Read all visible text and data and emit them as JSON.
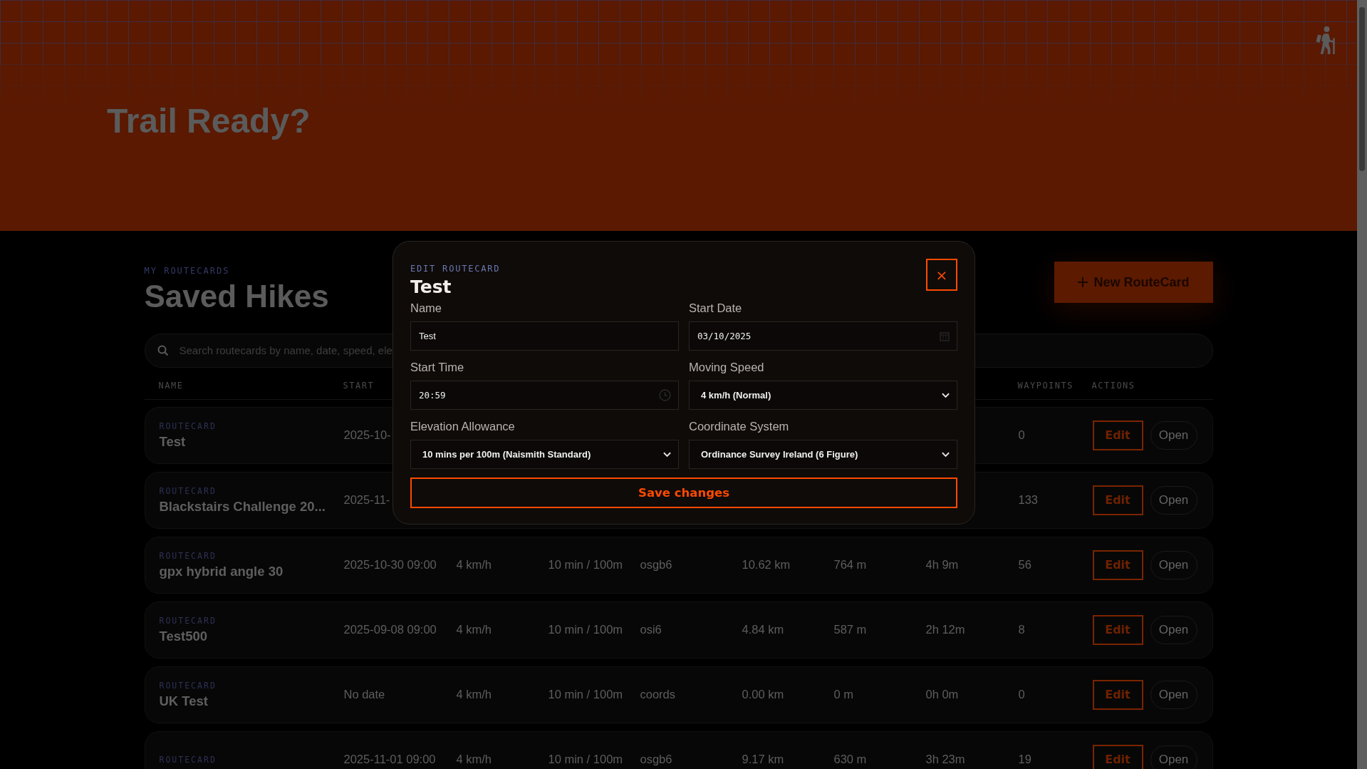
{
  "hero": {
    "title": "Trail Ready?"
  },
  "page": {
    "eyebrow": "MY ROUTECARDS",
    "title": "Saved Hikes",
    "new_button": {
      "label": "New RouteCard"
    }
  },
  "search": {
    "placeholder": "Search routecards by name, date, speed, ele"
  },
  "table": {
    "columns": [
      {
        "label": "NAME"
      },
      {
        "label": "START"
      },
      {
        "label": "WAYPOINTS"
      },
      {
        "label": "ACTIONS"
      }
    ],
    "rows": [
      {
        "label": "ROUTECARD",
        "name": "Test",
        "start": "2025-10-",
        "waypoints": "0",
        "actions": [
          "Edit",
          "Open"
        ]
      },
      {
        "label": "ROUTECARD",
        "name": "Blackstairs Challenge 20...",
        "start": "2025-11-",
        "waypoints": "133",
        "actions": [
          "Edit",
          "Open"
        ]
      },
      {
        "label": "ROUTECARD",
        "name": "gpx hybrid angle 30",
        "start": "2025-10-30 09:00",
        "speed": "4 km/h",
        "elevation": "10 min / 100m",
        "coords": "osgb6",
        "distance": "10.62 km",
        "ascent": "764 m",
        "time": "4h 9m",
        "waypoints": "56",
        "actions": [
          "Edit",
          "Open"
        ]
      },
      {
        "label": "ROUTECARD",
        "name": "Test500",
        "start": "2025-09-08 09:00",
        "speed": "4 km/h",
        "elevation": "10 min / 100m",
        "coords": "osi6",
        "distance": "4.84 km",
        "ascent": "587 m",
        "time": "2h 12m",
        "waypoints": "8",
        "actions": [
          "Edit",
          "Open"
        ]
      },
      {
        "label": "ROUTECARD",
        "name": "UK Test",
        "start": "No date",
        "speed": "4 km/h",
        "elevation": "10 min / 100m",
        "coords": "coords",
        "distance": "0.00 km",
        "ascent": "0 m",
        "time": "0h 0m",
        "waypoints": "0",
        "actions": [
          "Edit",
          "Open"
        ]
      },
      {
        "label": "ROUTECARD",
        "start": "2025-11-01 09:00",
        "speed": "4 km/h",
        "elevation": "10 min / 100m",
        "coords": "osgb6",
        "distance": "9.17 km",
        "ascent": "630 m",
        "time": "3h 23m",
        "waypoints": "19",
        "actions": [
          "Edit",
          "Open"
        ]
      }
    ]
  },
  "modal": {
    "eyebrow": "EDIT ROUTECARD",
    "title": "Test",
    "close": "×",
    "fields": [
      {
        "label": "Name",
        "kind": "text",
        "value": "Test"
      },
      {
        "label": "Start Date",
        "kind": "date",
        "value": "03/10/2025"
      },
      {
        "label": "Start Time",
        "kind": "time",
        "value": "20:59"
      },
      {
        "label": "Moving Speed",
        "kind": "select",
        "value": "4 km/h (Normal)"
      },
      {
        "label": "Elevation Allowance",
        "kind": "select",
        "value": "10 mins per 100m (Naismith Standard)"
      },
      {
        "label": "Coordinate System",
        "kind": "select",
        "value": "Ordinance Survey Ireland (6 Figure)"
      }
    ],
    "save_button": "Save changes"
  }
}
